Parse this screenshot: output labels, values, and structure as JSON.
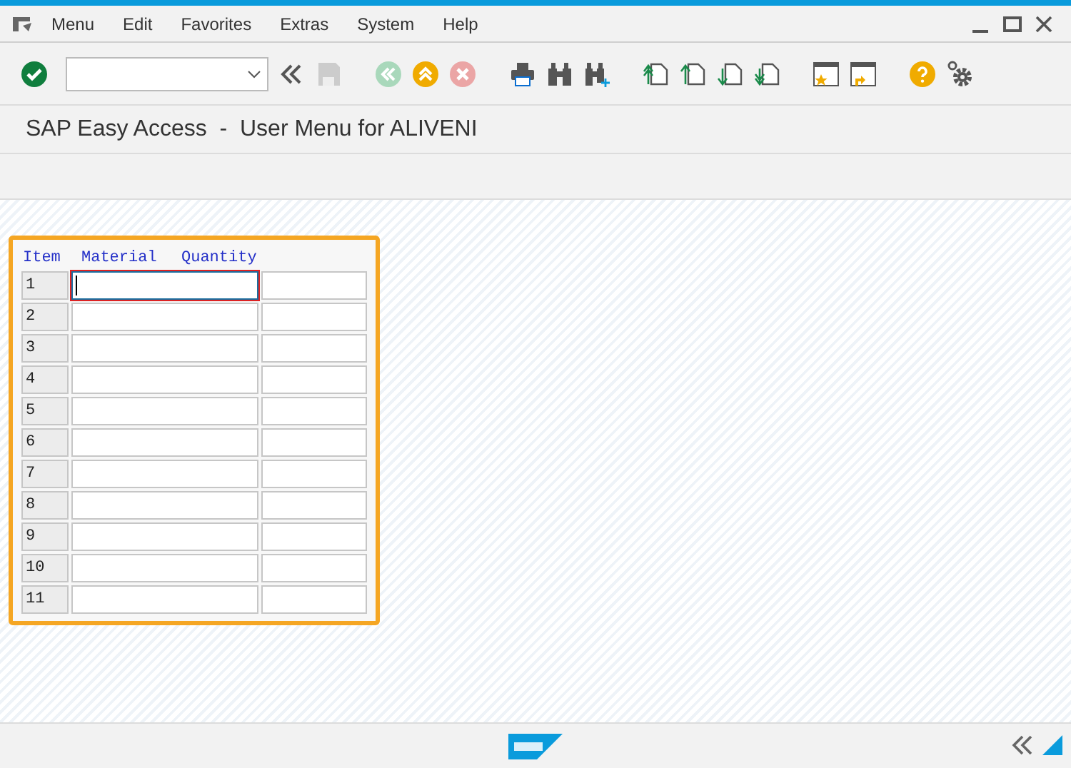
{
  "menu_bar": {
    "items": [
      "Menu",
      "Edit",
      "Favorites",
      "Extras",
      "System",
      "Help"
    ]
  },
  "screen_title": "SAP Easy Access  -  User Menu for ALIVENI",
  "table": {
    "columns": [
      "Item",
      "Material",
      "Quantity"
    ],
    "rows": [
      {
        "item": "1",
        "focused": true
      },
      {
        "item": "2",
        "focused": false
      },
      {
        "item": "3",
        "focused": false
      },
      {
        "item": "4",
        "focused": false
      },
      {
        "item": "5",
        "focused": false
      },
      {
        "item": "6",
        "focused": false
      },
      {
        "item": "7",
        "focused": false
      },
      {
        "item": "8",
        "focused": false
      },
      {
        "item": "9",
        "focused": false
      },
      {
        "item": "10",
        "focused": false
      },
      {
        "item": "11",
        "focused": false
      }
    ]
  }
}
